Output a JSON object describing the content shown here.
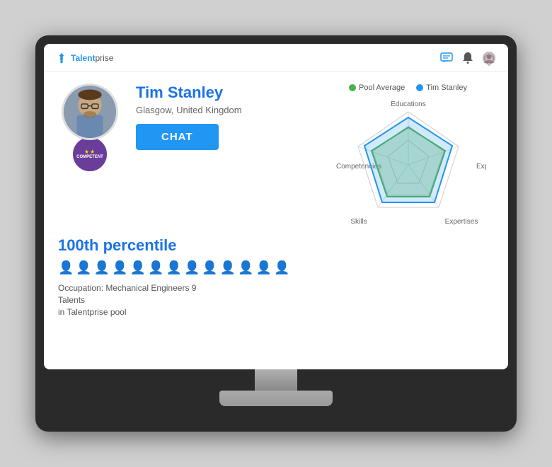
{
  "monitor": {
    "screen": {
      "header": {
        "logo_text_plain": "Talent",
        "logo_text_highlight": "prise",
        "icons": [
          "chat-icon",
          "bell-icon",
          "user-icon"
        ]
      },
      "profile": {
        "name": "Tim Stanley",
        "location": "Glasgow, United Kingdom",
        "chat_button": "CHAT",
        "badge_label": "COMPETENT",
        "badge_stars": "★★",
        "favorite_icon": "♡"
      },
      "radar": {
        "legend": [
          {
            "label": "Pool Average",
            "color": "#4CAF50"
          },
          {
            "label": "Tim Stanley",
            "color": "#2196F3"
          }
        ],
        "axes": [
          "Educations",
          "Experiences",
          "Expertises",
          "Skills",
          "Competencies"
        ]
      },
      "stats": {
        "percentile": "100th percentile",
        "people_count": 13,
        "occupation_line1": "Occupation: Mechanical Engineers 9 Talents",
        "occupation_line2": "in Talentprise pool"
      }
    }
  }
}
